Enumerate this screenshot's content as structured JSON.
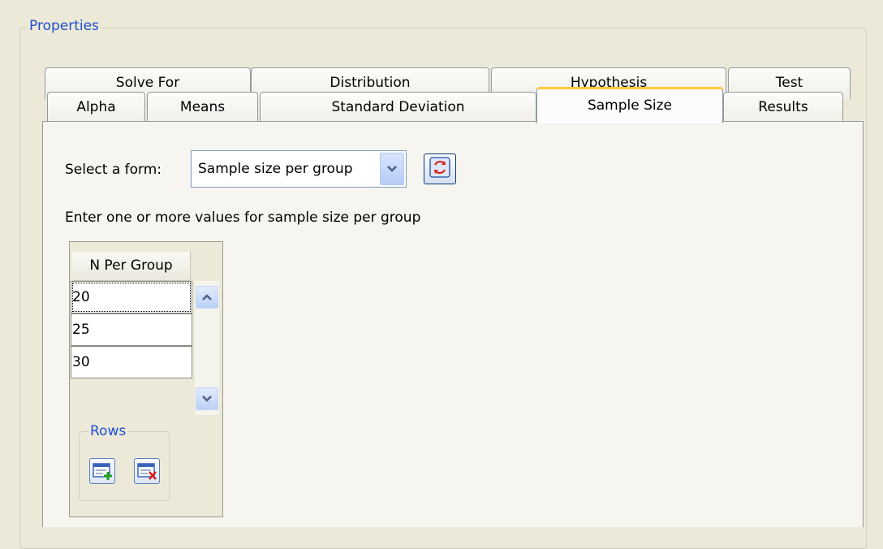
{
  "group_title": "Properties",
  "tabs_row1": [
    {
      "label": "Solve For"
    },
    {
      "label": "Distribution"
    },
    {
      "label": "Hypothesis"
    },
    {
      "label": "Test"
    }
  ],
  "tabs_row2": [
    {
      "label": "Alpha"
    },
    {
      "label": "Means"
    },
    {
      "label": "Standard Deviation"
    },
    {
      "label": "Sample Size",
      "active": true
    },
    {
      "label": "Results"
    }
  ],
  "form": {
    "select_label": "Select a form:",
    "selected_value": "Sample size per group",
    "refresh_icon": "refresh-icon"
  },
  "instructions": "Enter one or more values for sample size per group",
  "table": {
    "column_header": "N Per Group",
    "values": [
      "20",
      "25",
      "30"
    ]
  },
  "rows_group": {
    "title": "Rows",
    "add_icon": "add-row-icon",
    "delete_icon": "delete-row-icon"
  },
  "colors": {
    "background": "#ece9d8",
    "group_title": "#1f4fd0",
    "active_tab_accent": "#ffc83c"
  }
}
